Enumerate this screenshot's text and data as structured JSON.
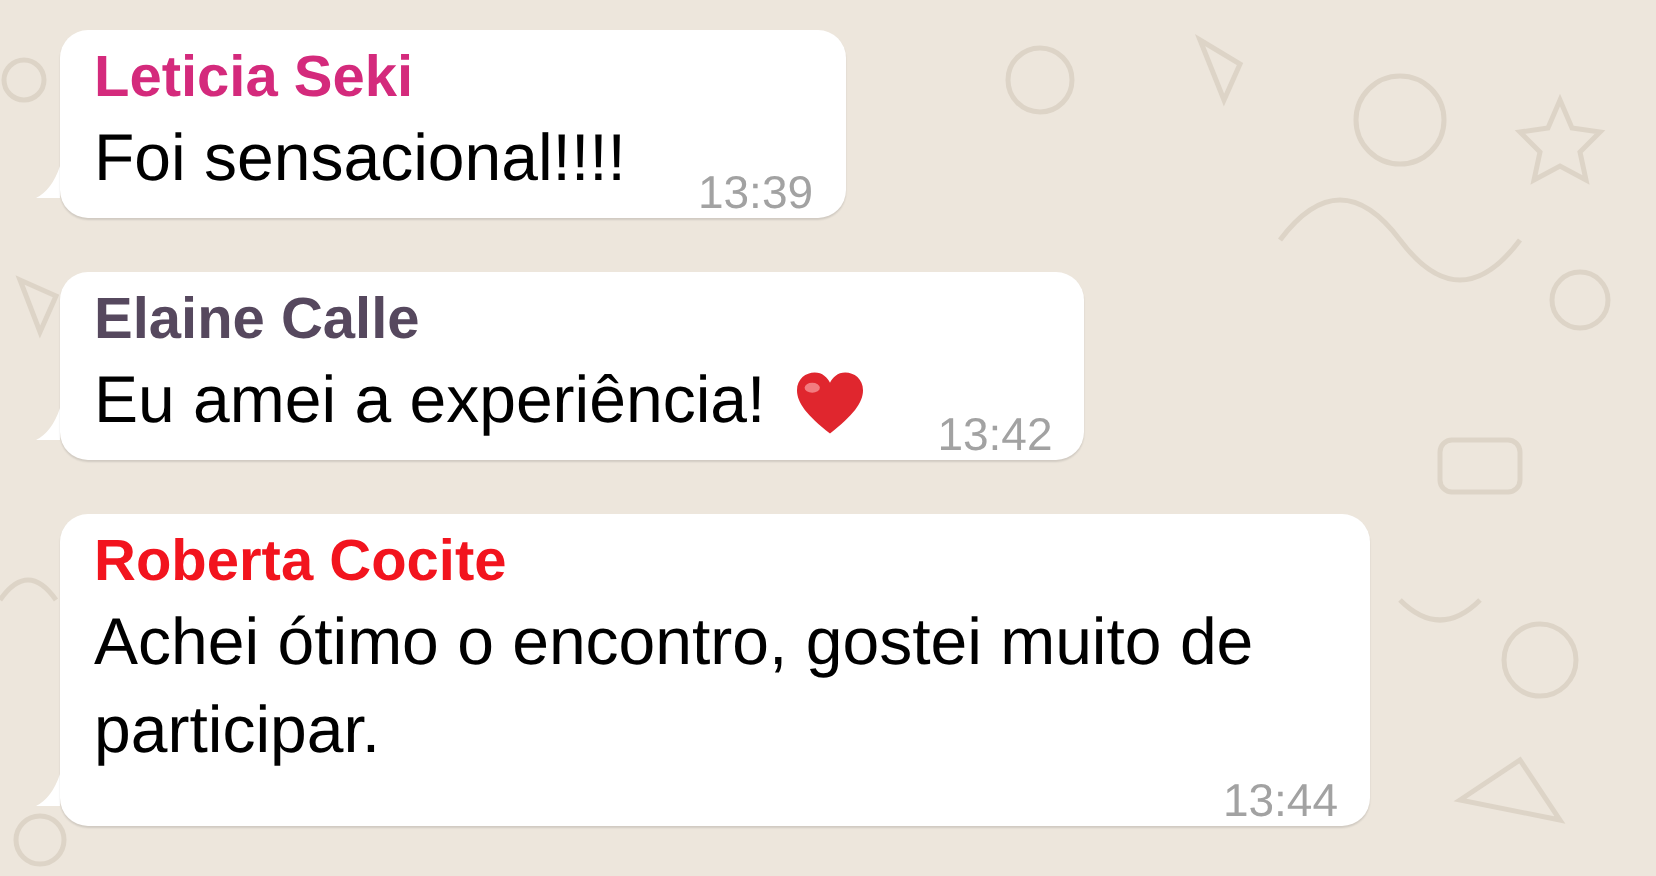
{
  "messages": [
    {
      "kind": "text",
      "sender": "Leticia Seki",
      "color": "#d42a7c",
      "text": "Foi sensacional!!!!",
      "time": "13:39"
    },
    {
      "kind": "emoji",
      "sender": "Elaine Calle",
      "color": "#56485e",
      "text": "Eu amei a experiência!",
      "time": "13:42"
    },
    {
      "kind": "text",
      "sender": "Roberta Cocite",
      "color": "#f2141e",
      "text": "Achei ótimo o encontro, gostei muito de participar.",
      "time": "13:44"
    }
  ]
}
